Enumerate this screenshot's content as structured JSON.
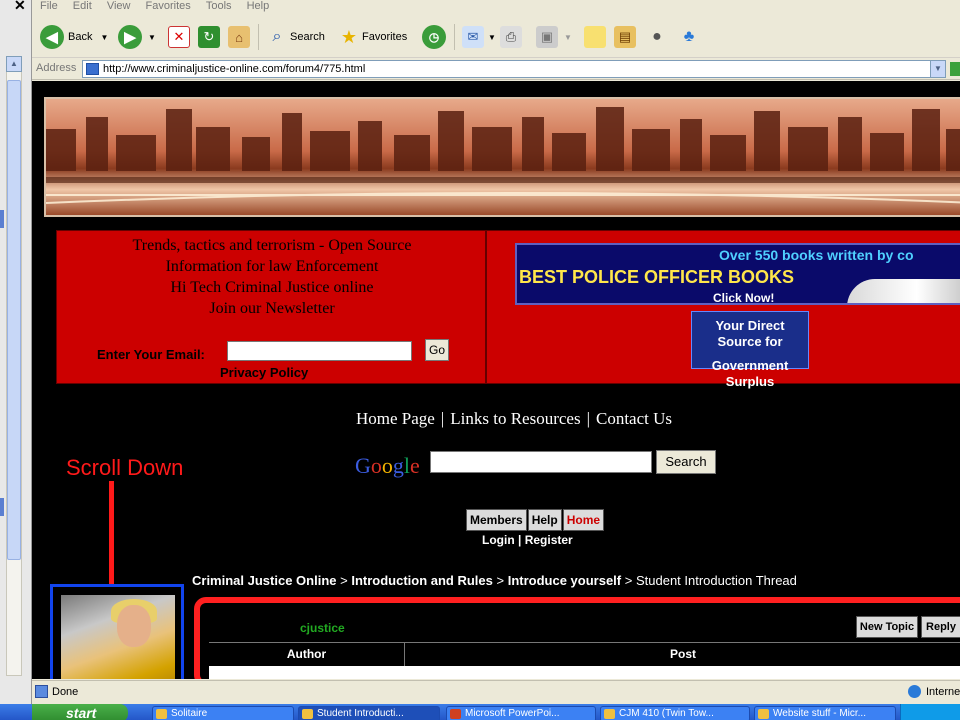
{
  "browser": {
    "menu": [
      "File",
      "Edit",
      "View",
      "Favorites",
      "Tools",
      "Help"
    ],
    "toolbar": {
      "back": "Back",
      "search": "Search",
      "favorites": "Favorites"
    },
    "address_label": "Address",
    "url": "http://www.criminaljustice-online.com/forum4/775.html",
    "status_text": "Done",
    "zone_text": "Interne"
  },
  "page": {
    "promo_lines": [
      "Trends, tactics and terrorism - Open Source",
      "Information for law Enforcement",
      "Hi Tech Criminal Justice online",
      "Join our Newsletter"
    ],
    "email_label": "Enter Your Email:",
    "go_label": "Go",
    "privacy": "Privacy Policy",
    "book_ad": {
      "top": "Over 550 books written by co",
      "mid": "BEST POLICE OFFICER BOOKS",
      "low": "Click Now!"
    },
    "surplus_ad": {
      "line1": "Your Direct Source for",
      "line2": "Government Surplus"
    },
    "nav_links": [
      "Home Page",
      "Links to Resources",
      "Contact Us"
    ],
    "google_logo": "Google",
    "search_button": "Search",
    "annotation": "Scroll Down",
    "forum_nav": [
      "Members",
      "Help",
      "Home"
    ],
    "login": "Login",
    "register": "Register",
    "breadcrumb": {
      "items": [
        "Criminal Justice Online",
        "Introduction and Rules",
        "Introduce yourself"
      ],
      "current": "Student Introduction Thread"
    },
    "username": "cjustice",
    "new_topic": "New Topic",
    "reply": "Reply",
    "columns": [
      "Author",
      "Post"
    ]
  },
  "taskbar": {
    "start": "start",
    "tasks": [
      "Solitaire",
      "Student Introducti...",
      "Microsoft PowerPoi...",
      "CJM 410 (Twin Tow...",
      "Website stuff - Micr..."
    ]
  },
  "colors": {
    "page_bg": "#000000",
    "promo_red": "#cc0000",
    "annotation_red": "#ff1a1a",
    "avatar_border": "#1144ee",
    "username_green": "#22aa22",
    "taskbar_blue": "#2456c8"
  }
}
